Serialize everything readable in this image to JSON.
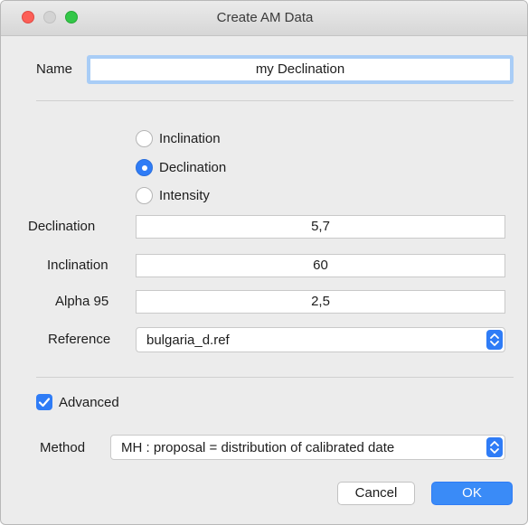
{
  "window": {
    "title": "Create AM Data"
  },
  "name": {
    "label": "Name",
    "value": "my Declination"
  },
  "measure_type": {
    "options": [
      {
        "label": "Inclination",
        "selected": false
      },
      {
        "label": "Declination",
        "selected": true
      },
      {
        "label": "Intensity",
        "selected": false
      }
    ]
  },
  "fields": {
    "declination": {
      "label": "Declination",
      "value": "5,7"
    },
    "inclination": {
      "label": "Inclination",
      "value": "60"
    },
    "alpha95": {
      "label": "Alpha 95",
      "value": "2,5"
    }
  },
  "reference": {
    "label": "Reference",
    "value": "bulgaria_d.ref"
  },
  "advanced": {
    "label": "Advanced",
    "checked": true
  },
  "method": {
    "label": "Method",
    "value": "MH : proposal = distribution of calibrated date"
  },
  "buttons": {
    "cancel": "Cancel",
    "ok": "OK"
  },
  "colors": {
    "accent": "#2f7cf6",
    "focus_ring": "#a9cdf6",
    "close": "#fc5f57",
    "zoom": "#33c748"
  },
  "icons": {
    "popup_arrows": "chevron-up-down-icon",
    "checkbox": "checkmark-icon"
  }
}
